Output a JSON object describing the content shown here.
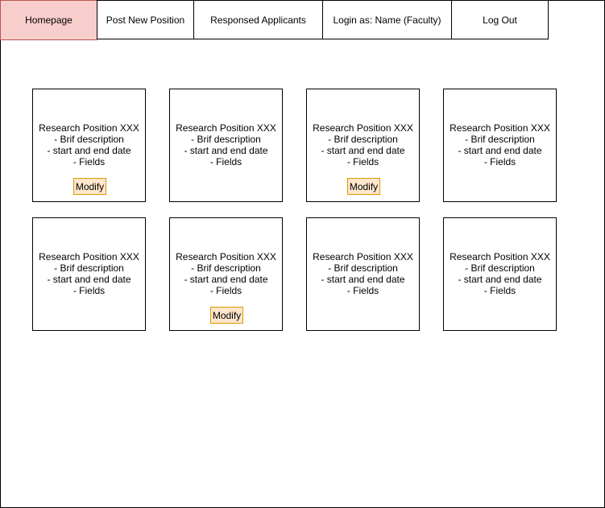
{
  "nav": {
    "home": "Homepage",
    "post": "Post New Position",
    "applicants": "Responsed Applicants",
    "login": "Login as: Name (Faculty)",
    "logout": "Log Out"
  },
  "colors": {
    "active_tab_fill": "#f8cecc",
    "active_tab_border": "#b85450",
    "modify_fill": "#ffe6cc",
    "modify_border": "#d79b00"
  },
  "cards": [
    {
      "title": "Research Position XXX",
      "line1": "- Brif description",
      "line2": "- start and end date",
      "line3": "- Fields",
      "button": "Modify"
    },
    {
      "title": "Research Position XXX",
      "line1": "- Brif description",
      "line2": "- start and end date",
      "line3": "- Fields"
    },
    {
      "title": "Research Position XXX",
      "line1": "- Brif description",
      "line2": "- start and end date",
      "line3": "- Fields",
      "button": "Modify"
    },
    {
      "title": "Research Position XXX",
      "line1": "- Brif description",
      "line2": "- start and end date",
      "line3": "- Fields"
    },
    {
      "title": "Research Position XXX",
      "line1": "- Brif description",
      "line2": "- start and end date",
      "line3": "- Fields"
    },
    {
      "title": "Research Position XXX",
      "line1": "- Brif description",
      "line2": "- start and end date",
      "line3": "- Fields",
      "button": "Modify"
    },
    {
      "title": "Research Position XXX",
      "line1": "- Brif description",
      "line2": "- start and end date",
      "line3": "- Fields"
    },
    {
      "title": "Research Position XXX",
      "line1": "- Brif description",
      "line2": "- start and end date",
      "line3": "- Fields"
    }
  ]
}
